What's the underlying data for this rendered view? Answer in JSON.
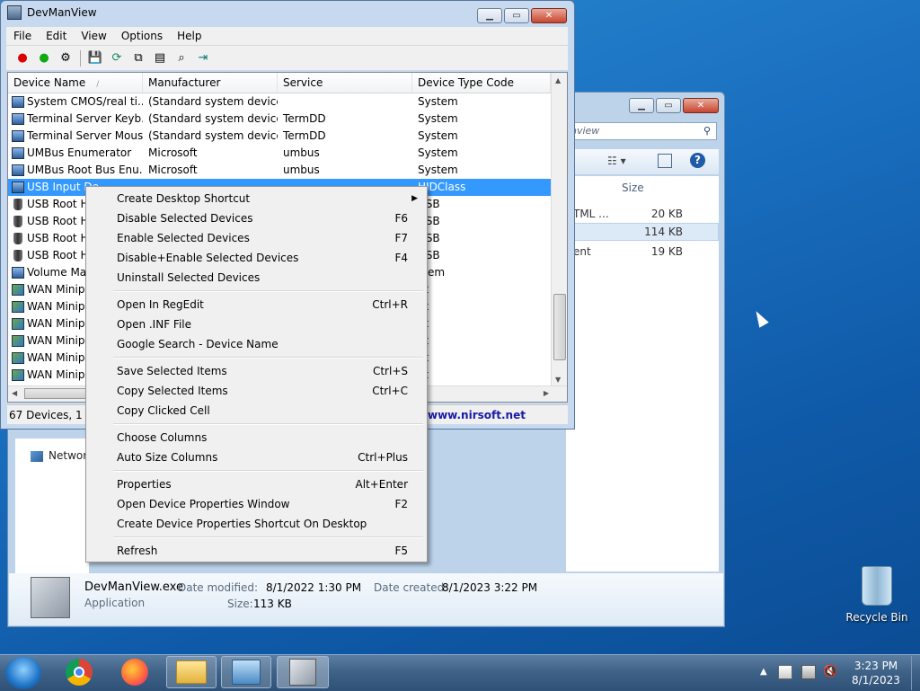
{
  "devmanview": {
    "title": "DevManView",
    "menu": [
      "File",
      "Edit",
      "View",
      "Options",
      "Help"
    ],
    "columns": [
      "Device Name",
      "Manufacturer",
      "Service",
      "Device Type Code"
    ],
    "rows": [
      {
        "name": "System CMOS/real ti...",
        "manufacturer": "(Standard system devices)",
        "service": "",
        "type": "System",
        "icon": "computer-icon"
      },
      {
        "name": "Terminal Server Keyb...",
        "manufacturer": "(Standard system devices)",
        "service": "TermDD",
        "type": "System",
        "icon": "computer-icon"
      },
      {
        "name": "Terminal Server Mous...",
        "manufacturer": "(Standard system devices)",
        "service": "TermDD",
        "type": "System",
        "icon": "computer-icon"
      },
      {
        "name": "UMBus Enumerator",
        "manufacturer": "Microsoft",
        "service": "umbus",
        "type": "System",
        "icon": "computer-icon"
      },
      {
        "name": "UMBus Root Bus Enu...",
        "manufacturer": "Microsoft",
        "service": "umbus",
        "type": "System",
        "icon": "computer-icon"
      },
      {
        "name": "USB Input De",
        "manufacturer": "",
        "service": "",
        "type": "HIDClass",
        "icon": "hid-icon",
        "selected": true
      },
      {
        "name": "USB Root Hu",
        "manufacturer": "",
        "service": "",
        "type": "USB",
        "icon": "usb-icon"
      },
      {
        "name": "USB Root Hu",
        "manufacturer": "",
        "service": "",
        "type": "USB",
        "icon": "usb-icon"
      },
      {
        "name": "USB Root Hu",
        "manufacturer": "",
        "service": "",
        "type": "USB",
        "icon": "usb-icon"
      },
      {
        "name": "USB Root Hu",
        "manufacturer": "",
        "service": "",
        "type": "USB",
        "icon": "usb-icon"
      },
      {
        "name": "Volume Mar",
        "manufacturer": "",
        "service": "",
        "type": "stem",
        "icon": "computer-icon"
      },
      {
        "name": "WAN Minipo",
        "manufacturer": "",
        "service": "",
        "type": "et",
        "icon": "network-adapter-icon"
      },
      {
        "name": "WAN Minipo",
        "manufacturer": "",
        "service": "",
        "type": "et",
        "icon": "network-adapter-icon"
      },
      {
        "name": "WAN Minipo",
        "manufacturer": "",
        "service": "",
        "type": "et",
        "icon": "network-adapter-icon"
      },
      {
        "name": "WAN Minipo",
        "manufacturer": "",
        "service": "",
        "type": "et",
        "icon": "network-adapter-icon"
      },
      {
        "name": "WAN Minipo",
        "manufacturer": "",
        "service": "",
        "type": "et",
        "icon": "network-adapter-icon"
      },
      {
        "name": "WAN Minipo",
        "manufacturer": "",
        "service": "",
        "type": "et",
        "icon": "network-adapter-icon"
      }
    ],
    "status_left": "67 Devices, 1 Sel",
    "status_link": "www.nirsoft.net"
  },
  "context_menu": [
    {
      "label": "Create Desktop Shortcut",
      "shortcut": "",
      "submenu": true
    },
    {
      "label": "Disable Selected Devices",
      "shortcut": "F6"
    },
    {
      "label": "Enable Selected Devices",
      "shortcut": "F7"
    },
    {
      "label": "Disable+Enable Selected Devices",
      "shortcut": "F4"
    },
    {
      "label": "Uninstall Selected Devices",
      "shortcut": ""
    },
    {
      "separator": true
    },
    {
      "label": "Open In RegEdit",
      "shortcut": "Ctrl+R"
    },
    {
      "label": "Open .INF File",
      "shortcut": ""
    },
    {
      "label": "Google Search - Device Name",
      "shortcut": ""
    },
    {
      "separator": true
    },
    {
      "label": "Save Selected Items",
      "shortcut": "Ctrl+S"
    },
    {
      "label": "Copy Selected Items",
      "shortcut": "Ctrl+C"
    },
    {
      "label": "Copy Clicked Cell",
      "shortcut": ""
    },
    {
      "separator": true
    },
    {
      "label": "Choose Columns",
      "shortcut": ""
    },
    {
      "label": "Auto Size Columns",
      "shortcut": "Ctrl+Plus"
    },
    {
      "separator": true
    },
    {
      "label": "Properties",
      "shortcut": "Alt+Enter"
    },
    {
      "label": "Open Device Properties Window",
      "shortcut": "F2"
    },
    {
      "label": "Create Device Properties Shortcut On Desktop",
      "shortcut": ""
    },
    {
      "separator": true
    },
    {
      "label": "Refresh",
      "shortcut": "F5"
    }
  ],
  "explorer": {
    "search_text": "nview",
    "column_size": "Size",
    "files": [
      {
        "name": "TML ...",
        "size": "20 KB"
      },
      {
        "name": "",
        "size": "114 KB",
        "selected": true
      },
      {
        "name": "ent",
        "size": "19 KB"
      }
    ],
    "nav_network": "Network",
    "details": {
      "filename": "DevManView.exe",
      "type": "Application",
      "modified_label": "Date modified:",
      "modified_value": "8/1/2022 1:30 PM",
      "created_label": "Date created:",
      "created_value": "8/1/2023 3:22 PM",
      "size_label": "Size:",
      "size_value": "113 KB"
    }
  },
  "desktop": {
    "recycle_bin": "Recycle Bin"
  },
  "taskbar": {
    "time": "3:23 PM",
    "date": "8/1/2023"
  }
}
